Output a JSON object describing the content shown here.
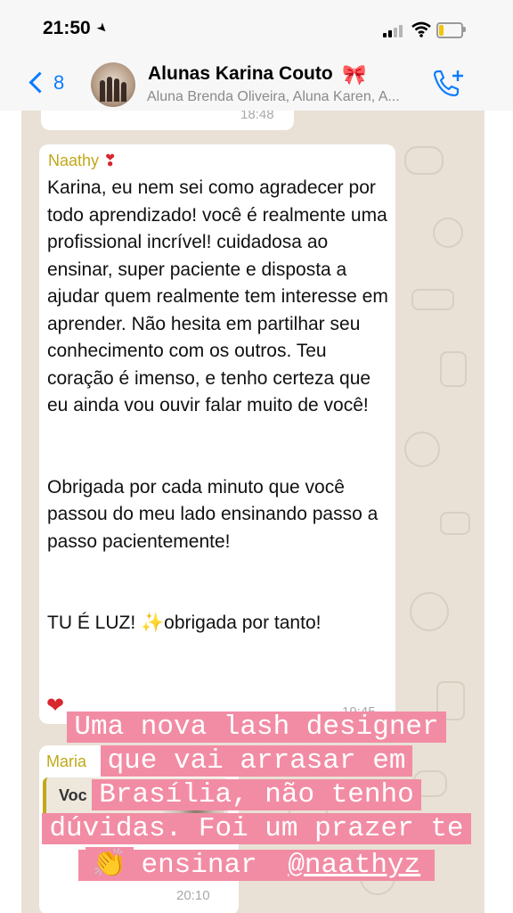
{
  "status": {
    "time": "21:50"
  },
  "header": {
    "back_count": "8",
    "title": "Alunas Karina Couto",
    "members": "Aluna Brenda Oliveira, Aluna Karen, A..."
  },
  "chat": {
    "prev_time": "18:48",
    "message": {
      "sender": "Naathy",
      "text": "Karina, eu nem sei como agradecer por todo aprendizado! você é realmente uma profissional incrível! cuidadosa ao ensinar, super paciente e disposta a ajudar quem realmente tem interesse em aprender. Não hesita em partilhar seu conhecimento com os outros. Teu coração é imenso, e tenho certeza que eu ainda vou ouvir falar muito de você!",
      "text2": "Obrigada por cada minuto que você passou do meu lado ensinando passo a passo pacientemente!",
      "text3": "TU É LUZ! ✨obrigada por tanto!",
      "time": "19:45"
    },
    "reply": {
      "sender": "Maria",
      "quote": "Voc",
      "time": "20:10"
    }
  },
  "overlay": {
    "line1": "Uma nova lash designer",
    "line2": "que vai arrasar em",
    "line3": "Brasília, não tenho",
    "line4": "dúvidas. Foi um prazer te",
    "line5": "ensinar",
    "handle": "@naathyz"
  }
}
